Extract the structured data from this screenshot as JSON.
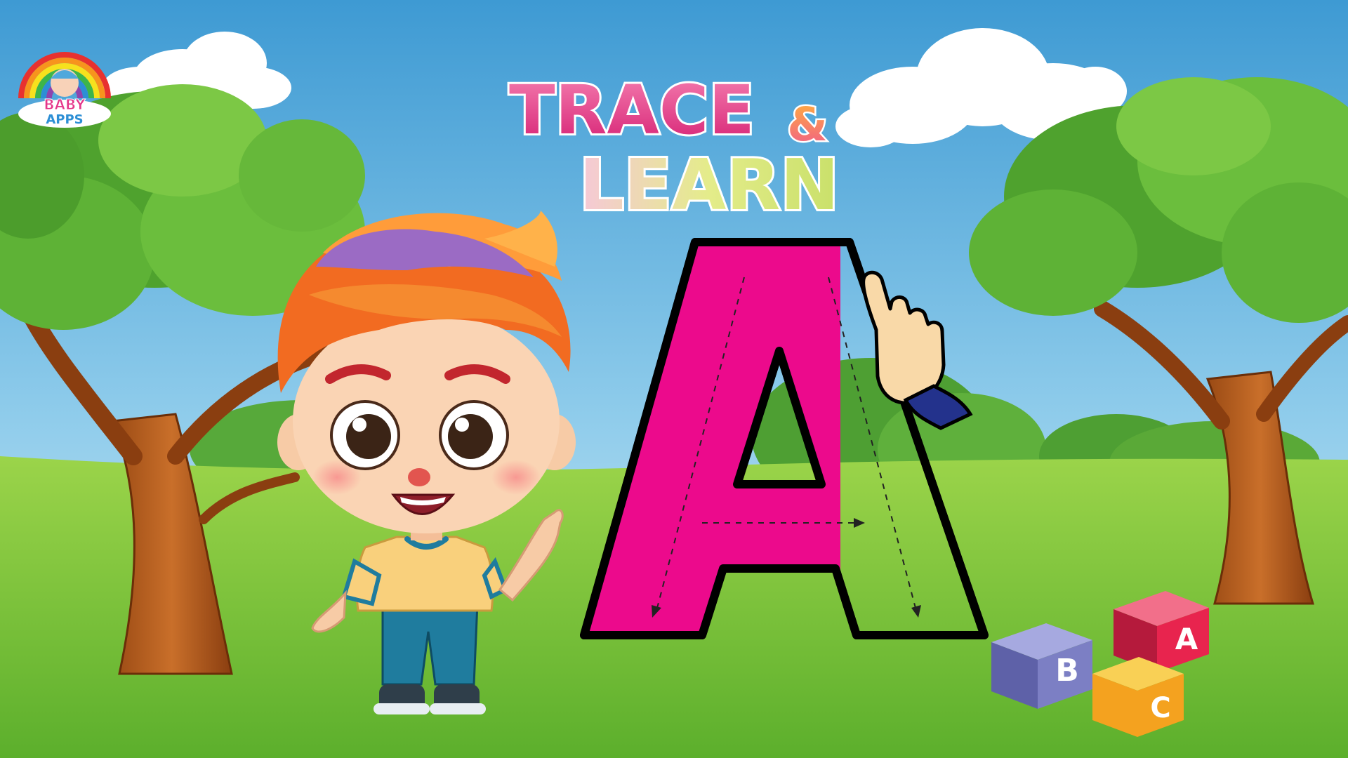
{
  "logo": {
    "line1": "BABY",
    "line2": "APPS"
  },
  "title": {
    "line1": "TRACE",
    "amp": "&",
    "line2": "LEARN"
  },
  "letter": {
    "glyph": "A",
    "fill_color": "#EC0A8C",
    "progress_fraction": 0.5
  },
  "blocks": [
    {
      "letter": "B",
      "color": "#7C7FC4"
    },
    {
      "letter": "A",
      "color": "#E8244E"
    },
    {
      "letter": "C",
      "color": "#F4A21F"
    }
  ],
  "colors": {
    "sky_top": "#3E9AD3",
    "sky_bottom": "#BFE3F4",
    "grass": "#7CC33A",
    "title_pink": "#E5368A",
    "title_yellow": "#D9E46A"
  },
  "icons": [
    "rainbow-logo-icon",
    "pointing-hand-icon",
    "toy-blocks-icon"
  ]
}
